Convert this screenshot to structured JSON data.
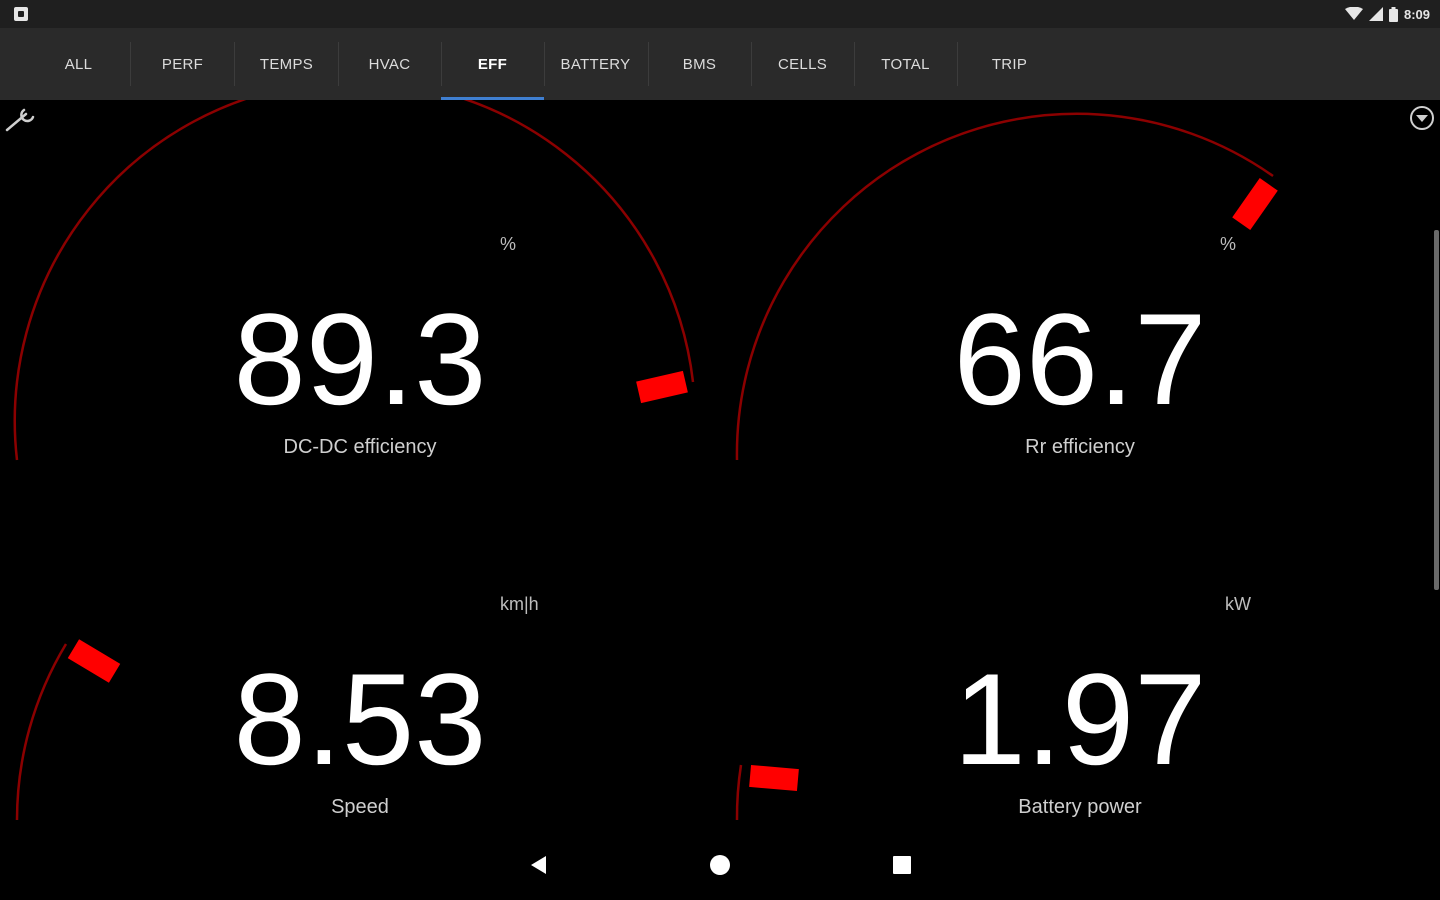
{
  "status_bar": {
    "time": "8:09"
  },
  "tabs": [
    {
      "label": "ALL",
      "active": false
    },
    {
      "label": "PERF",
      "active": false
    },
    {
      "label": "TEMPS",
      "active": false
    },
    {
      "label": "HVAC",
      "active": false
    },
    {
      "label": "EFF",
      "active": true
    },
    {
      "label": "BATTERY",
      "active": false
    },
    {
      "label": "BMS",
      "active": false
    },
    {
      "label": "CELLS",
      "active": false
    },
    {
      "label": "TOTAL",
      "active": false
    },
    {
      "label": "TRIP",
      "active": false
    }
  ],
  "gauges": [
    {
      "value": "89.3",
      "label": "DC-DC efficiency",
      "unit": "%"
    },
    {
      "value": "66.7",
      "label": "Rr efficiency",
      "unit": "%"
    },
    {
      "value": "8.53",
      "label": "Speed",
      "unit": "km|h"
    },
    {
      "value": "1.97",
      "label": "Battery power",
      "unit": "kW"
    }
  ],
  "icons": {
    "settings": "wrench-icon",
    "overflow": "chevron-circle-icon",
    "back": "back-triangle-icon",
    "home": "home-circle-icon",
    "recents": "recents-square-icon"
  },
  "colors": {
    "accent": "#ff0000",
    "arc": "#8b0000",
    "tab_indicator": "#3f7fd1",
    "tab_bar": "#2a2a2a",
    "status_bar": "#1f1f1f"
  }
}
